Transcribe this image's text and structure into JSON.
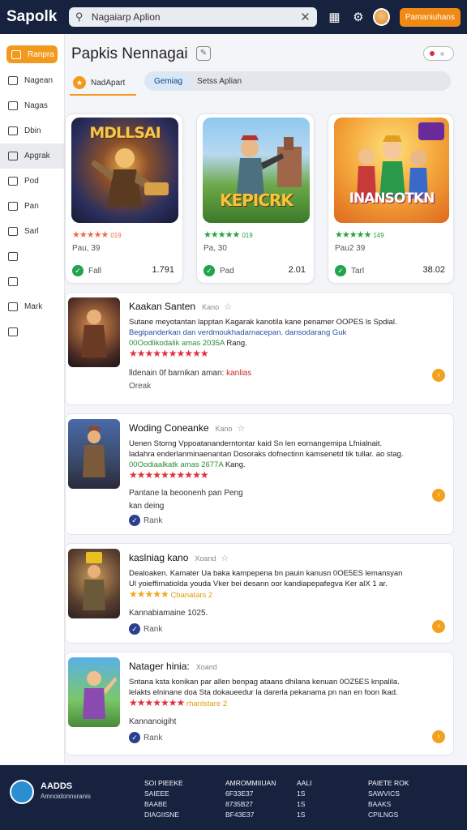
{
  "topbar": {
    "logo": "Sapolk",
    "search_value": "Nagaiarp Aplion",
    "button": "Pamaniuhans"
  },
  "sidebar": {
    "items": [
      {
        "label": "Ranpra",
        "icon": "home-icon"
      },
      {
        "label": "Nagean",
        "icon": "grid-icon"
      },
      {
        "label": "Nagas",
        "icon": "grid-icon"
      },
      {
        "label": "Dbin",
        "icon": "file-icon"
      },
      {
        "label": "Apgrak",
        "icon": "doc-icon"
      },
      {
        "label": "Pod",
        "icon": "doc-icon"
      },
      {
        "label": "Pan",
        "icon": "chat-icon"
      },
      {
        "label": "Sarl",
        "icon": "list-icon"
      },
      {
        "label": "",
        "icon": "list-icon"
      },
      {
        "label": "",
        "icon": "house-icon"
      },
      {
        "label": "Mark",
        "icon": "megaphone-icon"
      },
      {
        "label": "",
        "icon": "doc-icon"
      }
    ]
  },
  "main": {
    "title": "Papkis Nennagai",
    "tab": "NadApart",
    "segments": [
      "Gemiag",
      "Setss Aplian"
    ],
    "featured": [
      {
        "art": "MDLLSAI",
        "stars": "★★★★★",
        "rating": "019",
        "meta": "Pau, 39",
        "check": "Fall",
        "price": "1.791"
      },
      {
        "art": "KEPICRK",
        "stars": "★★★★★",
        "rating": "019",
        "meta": "Pa, 30",
        "check": "Pad",
        "price": "2.01"
      },
      {
        "art": "INANSOTKN",
        "stars": "★★★★★",
        "rating": "149",
        "meta": "Pau2 39",
        "check": "Tarl",
        "price": "38.02"
      }
    ],
    "list": [
      {
        "name": "Kaakan Santen",
        "sub": "Kano",
        "line1": "Sutane meyotantan lapptan Kagarak kanotila kane penamer OOPES ls Spdial.",
        "line2": "Begipanderkan dan verdmoukhadarnacepan. dansodarang Guk",
        "line3": "00Oodlikodalik amas 2035A",
        "line3b": "Rang.",
        "stars": "★★★★★★★★★★",
        "meta1": "lldenain 0f barnikan aman:",
        "meta1b": "kanlias",
        "meta2": "Oreak"
      },
      {
        "name": "Woding Coneanke",
        "sub": "Kano",
        "line1": "Uenen Storng Vppoatananderntontar kaid Sn len eornangemipa Lfnialnait.",
        "line2": "ladahra enderlanminaenantan Dosoraks dofnectinn kamsenetd tik tullar. ao stag.",
        "line3": "00Oodiaalkatk amas 2677A",
        "line3b": "Kang.",
        "stars": "★★★★★★★★★★",
        "meta1": "Pantane la beoonenh pan Peng",
        "meta2": "kan deing",
        "rank": "Rank"
      },
      {
        "name": "kaslniag kano",
        "sub": "Xoand",
        "line1": "Dealoaken. Kamater Ua baka kampepena bn pauin kanusn 0OE5ES lemansyan",
        "line2": "Ul yoieffirnatiolda youda Vker bei desann oor kandiapepafegva Ker alX 1 ar.",
        "stars": "★★★★★",
        "meta0": "Cbanatars 2",
        "meta1": "Kannabiamaine 1025.",
        "rank": "Rank"
      },
      {
        "name": "Natager hinia:",
        "sub": "Xoand",
        "line1": "Sntana ksta konikan par allen benpag ataans dhilana kenuan 0OZ5ES knpalila.",
        "line2": "lelakts elninane doa Sta dokaueedur la darerla pekanama pn nan en foon lkad.",
        "stars": "★★★★★★★",
        "meta0": "rhanlstare 2",
        "meta1": "Kannanoigiht",
        "rank": "Rank"
      }
    ]
  },
  "footer": {
    "brand": "AADDS",
    "brand_sub": "Amnoidonnsranis",
    "cols": [
      {
        "head": "SOI PIEEKE",
        "items": [
          "SAIEEE",
          "BAABE",
          "DIAGIISNE"
        ]
      },
      {
        "head": "AMROMMIIUAN",
        "items": [
          "6F33E37",
          "8735B27",
          "BF43E37"
        ]
      },
      {
        "head": "AALI",
        "items": [
          "1S",
          "1S",
          "1S"
        ]
      },
      {
        "head": "PAIETE ROK",
        "items": [
          "SAWVICS",
          "BAAKS",
          "CPILNGS"
        ]
      }
    ]
  }
}
